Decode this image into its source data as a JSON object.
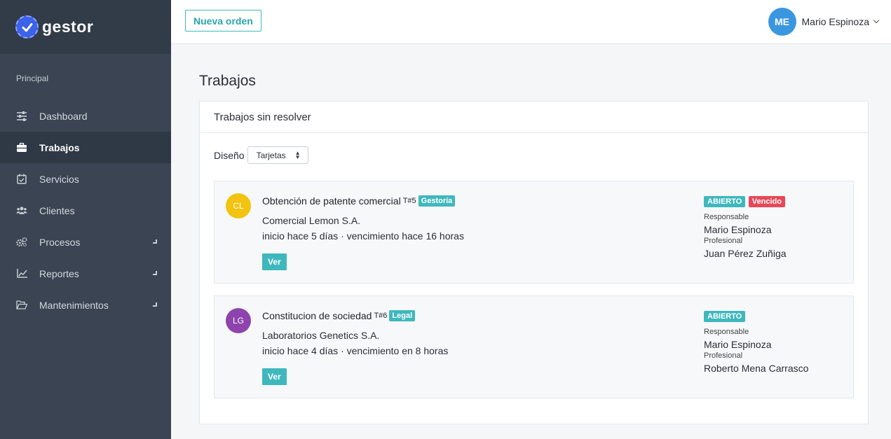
{
  "brand": {
    "name": "gestor"
  },
  "sidebar": {
    "section_label": "Principal",
    "items": [
      {
        "label": "Dashboard",
        "icon": "sliders-icon"
      },
      {
        "label": "Trabajos",
        "icon": "briefcase-icon",
        "active": true
      },
      {
        "label": "Servicios",
        "icon": "calendar-check-icon"
      },
      {
        "label": "Clientes",
        "icon": "users-icon"
      },
      {
        "label": "Procesos",
        "icon": "cogs-icon",
        "expandable": true
      },
      {
        "label": "Reportes",
        "icon": "line-chart-icon",
        "expandable": true
      },
      {
        "label": "Mantenimientos",
        "icon": "folder-open-icon",
        "expandable": true
      }
    ]
  },
  "topbar": {
    "new_order_label": "Nueva orden",
    "user": {
      "initials": "ME",
      "name": "Mario Espinoza"
    }
  },
  "page": {
    "title": "Trabajos"
  },
  "panel": {
    "title": "Trabajos sin resolver",
    "design_label": "Diseño",
    "design_select_value": "Tarjetas"
  },
  "jobs": [
    {
      "initials": "CL",
      "avatar_color": "#f2c40f",
      "title": "Obtención de patente comercial",
      "code": "T#5",
      "tag": "Gestoría",
      "tag_color": "#3fb8bd",
      "client": "Comercial Lemon S.A.",
      "timing": "inicio hace 5 días · vencimiento hace 16 horas",
      "button_label": "Ver",
      "status": "ABIERTO",
      "status_color": "#3fb8bd",
      "overdue": "Vencido",
      "overdue_color": "#e84758",
      "responsible_label": "Responsable",
      "responsible": "Mario Espinoza",
      "professional_label": "Profesional",
      "professional": "Juan Pérez Zuñiga"
    },
    {
      "initials": "LG",
      "avatar_color": "#8e44ad",
      "title": "Constitucion de sociedad",
      "code": "T#6",
      "tag": "Legal",
      "tag_color": "#3fb8bd",
      "client": "Laboratorios Genetics S.A.",
      "timing": "inicio hace 4 días · vencimiento en 8 horas",
      "button_label": "Ver",
      "status": "ABIERTO",
      "status_color": "#3fb8bd",
      "responsible_label": "Responsable",
      "responsible": "Mario Espinoza",
      "professional_label": "Profesional",
      "professional": "Roberto Mena Carrasco"
    }
  ]
}
